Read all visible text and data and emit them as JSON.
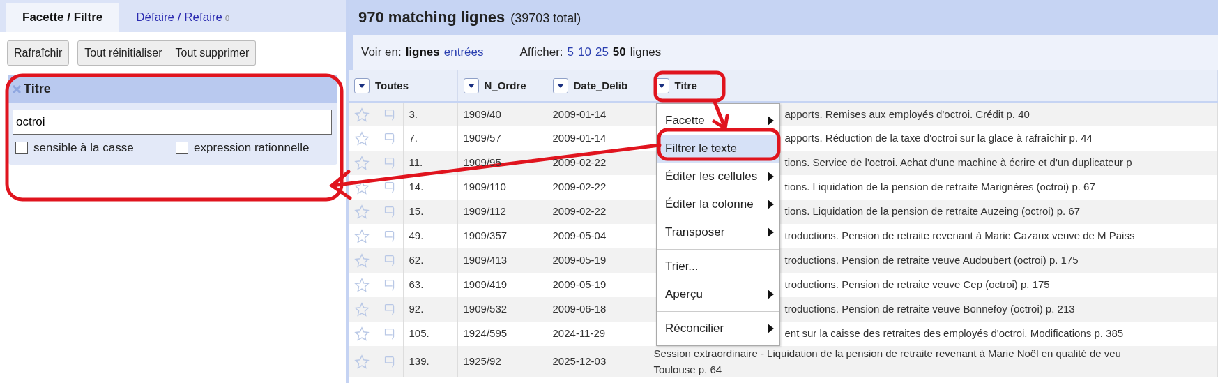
{
  "tabs": [
    {
      "label": "Facette / Filtre",
      "selected": true
    },
    {
      "label": "Défaire / Refaire",
      "count": "0",
      "selected": false
    }
  ],
  "facet_toolbar": {
    "refresh": "Rafraîchir",
    "group": [
      "Tout réinitialiser",
      "Tout supprimer"
    ]
  },
  "facet": {
    "title": "Titre",
    "value": "octroi",
    "options": [
      {
        "label": "sensible à la casse",
        "checked": false
      },
      {
        "label": "expression rationnelle",
        "checked": false
      }
    ]
  },
  "summary": {
    "count": "970 matching lignes",
    "total": "(39703 total)"
  },
  "view": {
    "label": "Voir en:",
    "modes": [
      {
        "label": "lignes",
        "selected": true
      },
      {
        "label": "entrées",
        "selected": false
      }
    ]
  },
  "page_size": {
    "label": "Afficher:",
    "options": [
      {
        "label": "5",
        "selected": false
      },
      {
        "label": "10",
        "selected": false
      },
      {
        "label": "25",
        "selected": false
      },
      {
        "label": "50",
        "selected": true
      }
    ],
    "unit": "lignes"
  },
  "columns": [
    "Toutes",
    "N_Ordre",
    "Date_Delib",
    "Titre"
  ],
  "rows": [
    {
      "index": "3.",
      "n_ordre": "1909/40",
      "date": "2009-01-14",
      "titre": "apports. Remises aux employés d'octroi. Crédit p. 40"
    },
    {
      "index": "7.",
      "n_ordre": "1909/57",
      "date": "2009-01-14",
      "titre": "apports. Réduction de la taxe d'octroi sur la glace à rafraîchir p. 44"
    },
    {
      "index": "11.",
      "n_ordre": "1909/95",
      "date": "2009-02-22",
      "titre": "tions. Service de l'octroi. Achat d'une machine à écrire et d'un duplicateur p"
    },
    {
      "index": "14.",
      "n_ordre": "1909/110",
      "date": "2009-02-22",
      "titre": "tions. Liquidation de la pension de retraite Marignères (octroi) p. 67"
    },
    {
      "index": "15.",
      "n_ordre": "1909/112",
      "date": "2009-02-22",
      "titre": "tions. Liquidation de la pension de retraite Auzeing (octroi) p. 67"
    },
    {
      "index": "49.",
      "n_ordre": "1909/357",
      "date": "2009-05-04",
      "titre": "troductions. Pension de retraite revenant à Marie Cazaux veuve de M Paiss"
    },
    {
      "index": "62.",
      "n_ordre": "1909/413",
      "date": "2009-05-19",
      "titre": "troductions. Pension de retraite veuve Audoubert (octroi) p. 175"
    },
    {
      "index": "63.",
      "n_ordre": "1909/419",
      "date": "2009-05-19",
      "titre": "troductions. Pension de retraite veuve Cep (octroi) p. 175"
    },
    {
      "index": "92.",
      "n_ordre": "1909/532",
      "date": "2009-06-18",
      "titre": "troductions. Pension de retraite veuve Bonnefoy (octroi) p. 213"
    },
    {
      "index": "105.",
      "n_ordre": "1924/595",
      "date": "2024-11-29",
      "titre": "ent sur la caisse des retraites des employés d'octroi. Modifications p. 385"
    },
    {
      "index": "139.",
      "n_ordre": "1925/92",
      "date": "2025-12-03",
      "titre": "Session extraordinaire - Liquidation de la pension de retraite revenant à Marie Noël en qualité de veu\nToulouse p. 64"
    }
  ],
  "menu": [
    {
      "kind": "item",
      "label": "Facette",
      "submenu": true,
      "selected": false
    },
    {
      "kind": "item",
      "label": "Filtrer le texte",
      "submenu": false,
      "selected": true
    },
    {
      "kind": "item",
      "label": "Éditer les cellules",
      "submenu": true,
      "selected": false
    },
    {
      "kind": "item",
      "label": "Éditer la colonne",
      "submenu": true,
      "selected": false
    },
    {
      "kind": "item",
      "label": "Transposer",
      "submenu": true,
      "selected": false
    },
    {
      "kind": "separator"
    },
    {
      "kind": "item",
      "label": "Trier...",
      "submenu": false,
      "selected": false
    },
    {
      "kind": "item",
      "label": "Aperçu",
      "submenu": true,
      "selected": false
    },
    {
      "kind": "separator"
    },
    {
      "kind": "item",
      "label": "Réconcilier",
      "submenu": true,
      "selected": false
    }
  ]
}
